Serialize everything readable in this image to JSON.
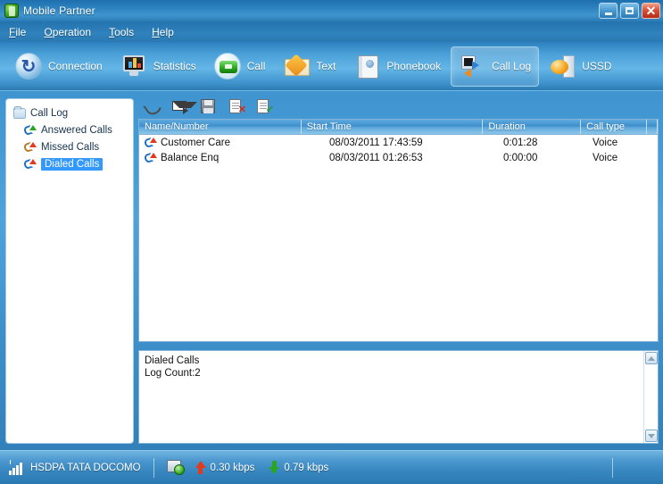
{
  "window": {
    "title": "Mobile Partner",
    "icon": "app-icon",
    "controls": {
      "minimize": "Minimize",
      "maximize": "Maximize",
      "close": "Close"
    }
  },
  "menubar": {
    "items": [
      {
        "label": "File",
        "accel": "F"
      },
      {
        "label": "Operation",
        "accel": "O"
      },
      {
        "label": "Tools",
        "accel": "T"
      },
      {
        "label": "Help",
        "accel": "H"
      }
    ]
  },
  "toolbar": {
    "items": [
      {
        "label": "Connection",
        "icon": "connection-icon",
        "active": false
      },
      {
        "label": "Statistics",
        "icon": "statistics-icon",
        "active": false
      },
      {
        "label": "Call",
        "icon": "call-icon",
        "active": false
      },
      {
        "label": "Text",
        "icon": "text-icon",
        "active": false
      },
      {
        "label": "Phonebook",
        "icon": "phonebook-icon",
        "active": false
      },
      {
        "label": "Call Log",
        "icon": "call-log-icon",
        "active": true
      },
      {
        "label": "USSD",
        "icon": "ussd-icon",
        "active": false
      }
    ]
  },
  "sidebar": {
    "root": {
      "label": "Call Log",
      "icon": "folder-icon"
    },
    "items": [
      {
        "label": "Answered Calls",
        "icon": "phone-incoming-icon",
        "selected": false
      },
      {
        "label": "Missed Calls",
        "icon": "phone-missed-icon",
        "selected": false
      },
      {
        "label": "Dialed Calls",
        "icon": "phone-outgoing-icon",
        "selected": true
      }
    ]
  },
  "content_toolbar": {
    "buttons": [
      {
        "name": "call-button",
        "icon": "handset-icon",
        "enabled": true
      },
      {
        "name": "send-message-button",
        "icon": "envelope-send-icon",
        "enabled": true
      },
      {
        "name": "save-button",
        "icon": "floppy-disk-icon",
        "enabled": true
      },
      {
        "name": "delete-button",
        "icon": "document-x-icon",
        "enabled": false
      },
      {
        "name": "export-button",
        "icon": "document-check-icon",
        "enabled": false
      }
    ]
  },
  "table": {
    "columns": [
      "Name/Number",
      "Start Time",
      "Duration",
      "Call type"
    ],
    "rows": [
      {
        "icon": "phone-outgoing-icon",
        "name": "Customer Care",
        "start_time": "08/03/2011 17:43:59",
        "duration": "0:01:28",
        "call_type": "Voice"
      },
      {
        "icon": "phone-outgoing-icon",
        "name": "Balance Enq",
        "start_time": "08/03/2011 01:26:53",
        "duration": "0:00:00",
        "call_type": "Voice"
      }
    ]
  },
  "log_panel": {
    "title": "Dialed Calls",
    "count_label": "Log Count:2",
    "text": "Dialed Calls\nLog Count:2",
    "scroll_up": "scroll-up",
    "scroll_down": "scroll-down"
  },
  "statusbar": {
    "network_type": "HSDPA",
    "operator": "TATA DOCOMO",
    "network_label": "HSDPA  TATA DOCOMO",
    "upload_rate": "0.30 kbps",
    "download_rate": "0.79 kbps",
    "signal_icon": "signal-bars-icon",
    "connection_icon": "connection-status-icon",
    "upload_icon": "arrow-up-icon",
    "download_icon": "arrow-down-icon"
  },
  "colors": {
    "accent": "#3f93cf",
    "title_bar": "#2e84c0",
    "selection": "#3399ff",
    "panel_bg": "#ffffff",
    "panel_border": "#7fb2d6",
    "upload_arrow": "#e23a1f",
    "download_arrow": "#2ba41f",
    "close_button": "#d9523a"
  }
}
